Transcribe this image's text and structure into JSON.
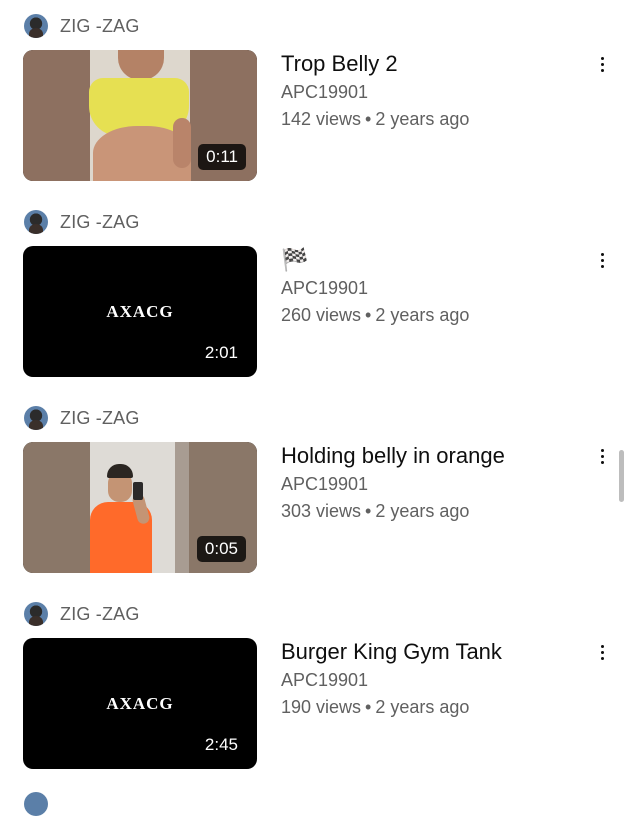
{
  "videos": [
    {
      "uploader": "ZIG -ZAG",
      "title": "Trop Belly 2",
      "channel": "APC19901",
      "views": "142 views",
      "age": "2 years ago",
      "duration": "0:11",
      "thumb_text": ""
    },
    {
      "uploader": "ZIG -ZAG",
      "title": "🏁",
      "channel": "APC19901",
      "views": "260 views",
      "age": "2 years ago",
      "duration": "2:01",
      "thumb_text": "AXACG"
    },
    {
      "uploader": "ZIG -ZAG",
      "title": "Holding belly in orange",
      "channel": "APC19901",
      "views": "303 views",
      "age": "2 years ago",
      "duration": "0:05",
      "thumb_text": ""
    },
    {
      "uploader": "ZIG -ZAG",
      "title": "Burger King Gym Tank",
      "channel": "APC19901",
      "views": "190 views",
      "age": "2 years ago",
      "duration": "2:45",
      "thumb_text": "AXACG"
    }
  ],
  "separator": "•"
}
